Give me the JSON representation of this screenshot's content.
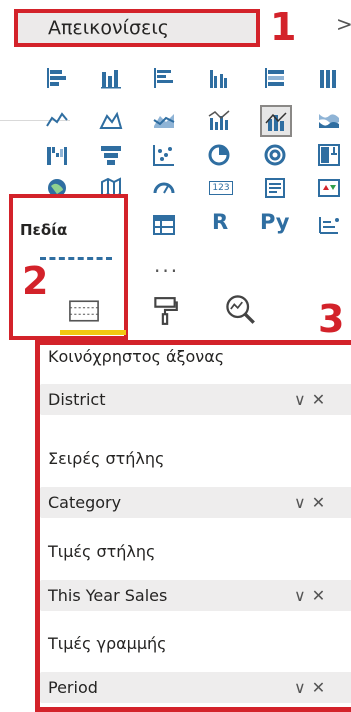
{
  "header": {
    "title": "Απεικονίσεις",
    "callout_1": "1",
    "collapse_glyph": ">"
  },
  "callouts": {
    "two": "2",
    "three": "3"
  },
  "fields_tab": {
    "label": "Πεδία"
  },
  "more_visuals": "...",
  "gallery_text": {
    "r": "R",
    "py": "Py",
    "num": "123"
  },
  "wells": [
    {
      "label": "Κοινόχρηστος άξονας",
      "value": "District"
    },
    {
      "label": "Σειρές στήλης",
      "value": "Category"
    },
    {
      "label": "Τιμές στήλης",
      "value": "This Year Sales"
    },
    {
      "label": "Τιμές γραμμής",
      "value": "Period"
    }
  ],
  "pill_controls": {
    "chevron": "∨",
    "remove": "✕"
  },
  "colors": {
    "accent_red": "#d3222a",
    "accent_yellow": "#f2c811",
    "icon_blue": "#2f6ea1"
  }
}
